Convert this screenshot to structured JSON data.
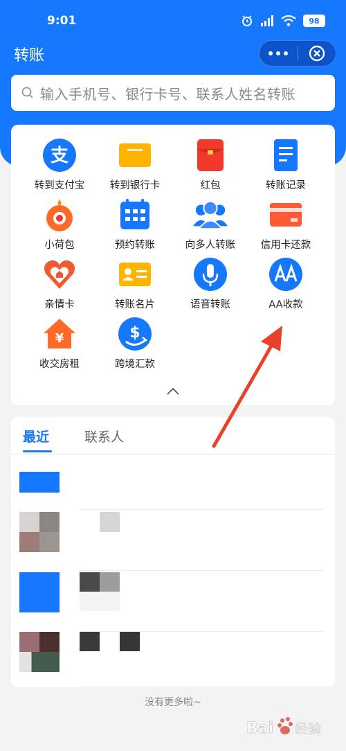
{
  "status_bar": {
    "time": "9:01",
    "battery": "98"
  },
  "header": {
    "title": "转账"
  },
  "search": {
    "placeholder": "输入手机号、银行卡号、联系人姓名转账"
  },
  "grid": {
    "items": [
      {
        "label": "转到支付宝",
        "icon": "alipay-icon"
      },
      {
        "label": "转到银行卡",
        "icon": "bank-card-icon"
      },
      {
        "label": "红包",
        "icon": "red-packet-icon"
      },
      {
        "label": "转账记录",
        "icon": "records-icon"
      },
      {
        "label": "小荷包",
        "icon": "purse-icon"
      },
      {
        "label": "预约转账",
        "icon": "calendar-icon"
      },
      {
        "label": "向多人转账",
        "icon": "people-icon"
      },
      {
        "label": "信用卡还款",
        "icon": "credit-card-icon"
      },
      {
        "label": "亲情卡",
        "icon": "family-card-icon"
      },
      {
        "label": "转账名片",
        "icon": "namecard-icon"
      },
      {
        "label": "语音转账",
        "icon": "microphone-icon"
      },
      {
        "label": "AA收款",
        "icon": "aa-icon"
      },
      {
        "label": "收交房租",
        "icon": "rent-icon"
      },
      {
        "label": "跨境汇款",
        "icon": "cross-border-icon"
      }
    ]
  },
  "tabs": {
    "recent": "最近",
    "contacts": "联系人"
  },
  "footer": {
    "no_more": "没有更多啦~"
  },
  "watermark": {
    "text": "Bai 经验"
  },
  "colors": {
    "brand_blue": "#1677ff",
    "annotation_arrow": "#e8412c"
  }
}
